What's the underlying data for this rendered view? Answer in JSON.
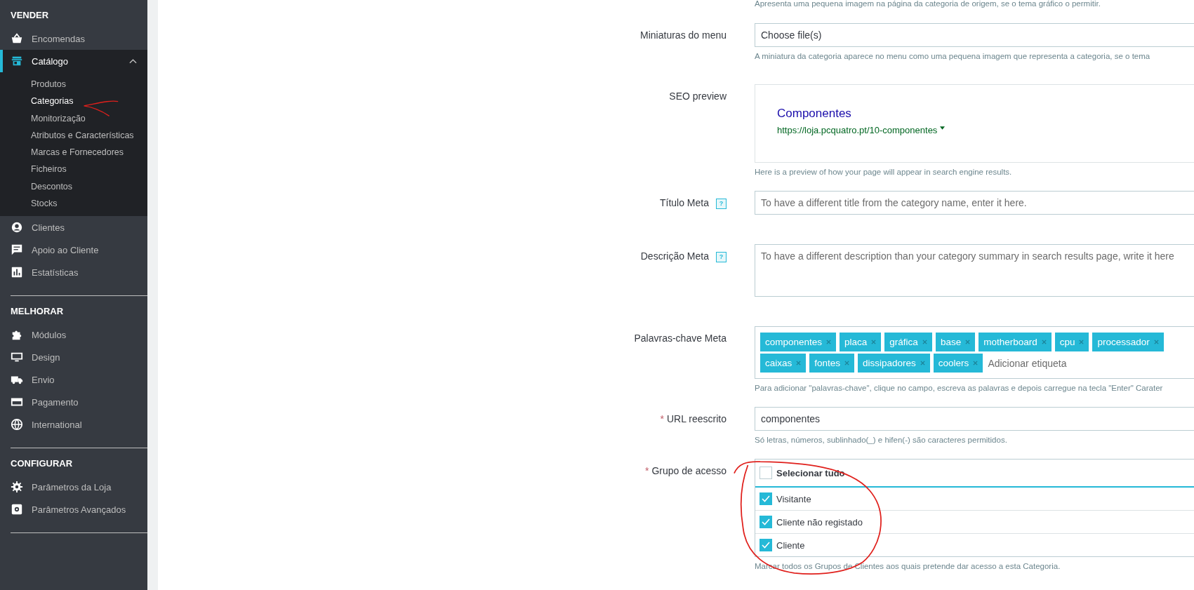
{
  "sidebar": {
    "sections": [
      {
        "title": "VENDER",
        "items": [
          {
            "label": "Encomendas",
            "selected": false
          },
          {
            "label": "Catálogo",
            "selected": true,
            "expanded": true,
            "children": [
              {
                "label": "Produtos",
                "selected": false
              },
              {
                "label": "Categorias",
                "selected": true
              },
              {
                "label": "Monitorização",
                "selected": false
              },
              {
                "label": "Atributos e Características",
                "selected": false
              },
              {
                "label": "Marcas e Fornecedores",
                "selected": false
              },
              {
                "label": "Ficheiros",
                "selected": false
              },
              {
                "label": "Descontos",
                "selected": false
              },
              {
                "label": "Stocks",
                "selected": false
              }
            ]
          },
          {
            "label": "Clientes",
            "selected": false
          },
          {
            "label": "Apoio ao Cliente",
            "selected": false
          },
          {
            "label": "Estatísticas",
            "selected": false
          }
        ]
      },
      {
        "title": "MELHORAR",
        "items": [
          {
            "label": "Módulos",
            "selected": false
          },
          {
            "label": "Design",
            "selected": false
          },
          {
            "label": "Envio",
            "selected": false
          },
          {
            "label": "Pagamento",
            "selected": false
          },
          {
            "label": "International",
            "selected": false
          }
        ]
      },
      {
        "title": "CONFIGURAR",
        "items": [
          {
            "label": "Parâmetros da Loja",
            "selected": false
          },
          {
            "label": "Parâmetros Avançados",
            "selected": false
          }
        ]
      }
    ]
  },
  "form": {
    "top_help": "Apresenta uma pequena imagem na página da categoria de origem, se o tema gráfico o permitir.",
    "fields": [
      {
        "kind": "file",
        "label": "Miniaturas do menu",
        "value": "Choose file(s)",
        "help": "A miniatura da categoria aparece no menu como uma pequena imagem que representa a categoria, se o tema"
      },
      {
        "kind": "seo",
        "label": "SEO preview",
        "title": "Componentes",
        "url": "https://loja.pcquatro.pt/10-componentes",
        "help": "Here is a preview of how your page will appear in search engine results."
      },
      {
        "kind": "text",
        "label": "Título Meta",
        "hint": "?",
        "placeholder": "To have a different title from the category name, enter it here."
      },
      {
        "kind": "textarea",
        "label": "Descrição Meta",
        "hint": "?",
        "placeholder": "To have a different description than your category summary in search results page, write it here"
      },
      {
        "kind": "tags",
        "label": "Palavras-chave Meta",
        "tags": [
          "componentes",
          "placa",
          "gráfica",
          "base",
          "motherboard",
          "cpu",
          "processador",
          "caixas",
          "fontes",
          "dissipadores",
          "coolers"
        ],
        "placeholder": "Adicionar etiqueta",
        "help": "Para adicionar \"palavras-chave\", clique no campo, escreva as palavras e depois carregue na tecla \"Enter\" Carater"
      },
      {
        "kind": "text",
        "label": "URL reescrito",
        "required_mark": "*",
        "value": "componentes",
        "help": "Só letras, números, sublinhado(_) e hifen(-) são caracteres permitidos."
      },
      {
        "kind": "checklist",
        "label": "Grupo de acesso",
        "required_mark": "*",
        "all_label": "Selecionar tudo",
        "all_checked": false,
        "options": [
          {
            "label": "Visitante",
            "checked": true
          },
          {
            "label": "Cliente não registado",
            "checked": true
          },
          {
            "label": "Cliente",
            "checked": true
          }
        ],
        "help": "Marcar todos os Grupos de Clientes aos quais pretende dar acesso a esta Categoria."
      }
    ]
  }
}
